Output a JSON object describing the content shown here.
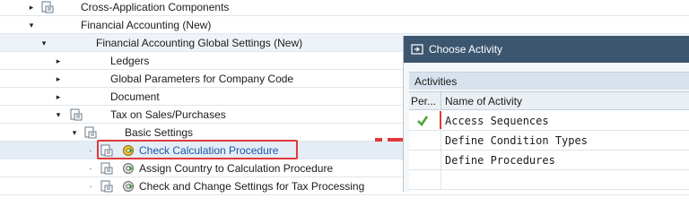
{
  "tree": {
    "nodes": [
      {
        "label": "Cross-Application Components",
        "toggle": "▸"
      },
      {
        "label": "Financial Accounting (New)",
        "toggle": "▾"
      },
      {
        "label": "Financial Accounting Global Settings (New)",
        "toggle": "▾"
      },
      {
        "label": "Ledgers",
        "toggle": "▸"
      },
      {
        "label": "Global Parameters for Company Code",
        "toggle": "▸"
      },
      {
        "label": "Document",
        "toggle": "▸"
      },
      {
        "label": "Tax on Sales/Purchases",
        "toggle": "▾"
      },
      {
        "label": "Basic Settings",
        "toggle": "▾"
      },
      {
        "label": "Check Calculation Procedure",
        "toggle": "·"
      },
      {
        "label": "Assign Country to Calculation Procedure",
        "toggle": "·"
      },
      {
        "label": "Check and Change Settings for Tax Processing",
        "toggle": "·"
      }
    ]
  },
  "dialog": {
    "title": "Choose Activity",
    "section_label": "Activities",
    "columns": [
      "Per...",
      "Name of Activity"
    ],
    "rows": [
      {
        "name": "Access Sequences",
        "performed": true
      },
      {
        "name": "Define Condition Types",
        "performed": false
      },
      {
        "name": "Define Procedures",
        "performed": false
      }
    ]
  },
  "colors": {
    "titlebar": "#3c5670",
    "highlight_red": "#e2383a",
    "link_blue": "#1a57a8"
  }
}
